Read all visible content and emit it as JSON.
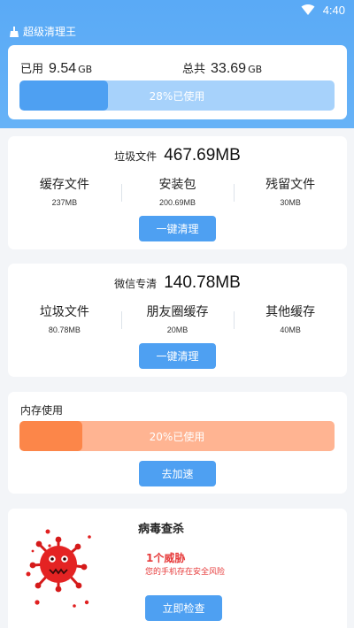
{
  "status": {
    "time": "4:40"
  },
  "app": {
    "title": "超级清理王"
  },
  "storage": {
    "used_label": "已用",
    "used_value": "9.54",
    "used_unit": "GB",
    "total_label": "总共",
    "total_value": "33.69",
    "total_unit": "GB",
    "progress": 0.28,
    "progress_text": "28%已使用"
  },
  "junk": {
    "title": "垃圾文件",
    "size": "467.69MB",
    "items": [
      {
        "label": "缓存文件",
        "value": "237MB"
      },
      {
        "label": "安装包",
        "value": "200.69MB"
      },
      {
        "label": "残留文件",
        "value": "30MB"
      }
    ],
    "button": "一键清理"
  },
  "wechat": {
    "title": "微信专清",
    "size": "140.78MB",
    "items": [
      {
        "label": "垃圾文件",
        "value": "80.78MB"
      },
      {
        "label": "朋友圈缓存",
        "value": "20MB"
      },
      {
        "label": "其他缓存",
        "value": "40MB"
      }
    ],
    "button": "一键清理"
  },
  "memory": {
    "title": "内存使用",
    "progress": 0.2,
    "progress_text": "20%已使用",
    "button": "去加速"
  },
  "virus": {
    "title": "病毒查杀",
    "threat": "1个威胁",
    "description": "您的手机存在安全风险",
    "button": "立即检查"
  },
  "colors": {
    "primary": "#4ea0f2",
    "primary_light": "#a7d2fb",
    "memory_fill": "#fc8649",
    "memory_track": "#ffb492",
    "danger": "#e63a3a"
  }
}
